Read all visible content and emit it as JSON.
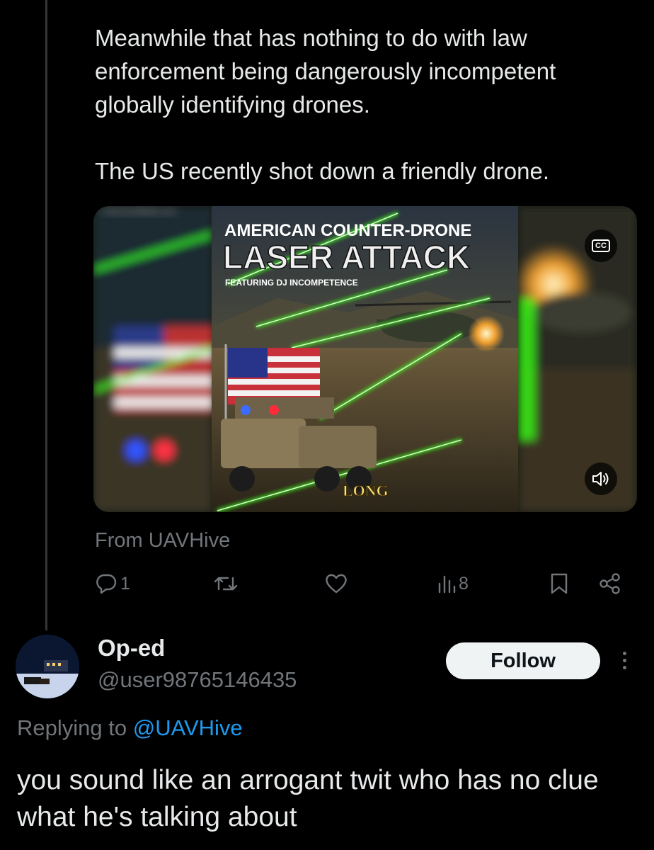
{
  "tweet": {
    "text_paragraph_1": "Meanwhile that has nothing to do with law enforcement being dangerously incompetent globally identifying drones.",
    "text_paragraph_2": "The US recently shot down a friendly drone.",
    "media": {
      "title_line_1": "AMERICAN COUNTER-DRONE",
      "title_line_2": "LASER ATTACK",
      "subtitle": "FEATURING DJ INCOMPETENCE",
      "badge": "LONG",
      "blur_text": "FEATURING DJ",
      "cc_label": "CC",
      "cc_icon": "closed-captions-icon",
      "mute_icon": "speaker-icon"
    },
    "source_label": "From UAVHive",
    "actions": {
      "reply_count": "1",
      "retweet_count": "",
      "like_count": "",
      "views_count": "8",
      "reply_icon": "reply-icon",
      "retweet_icon": "retweet-icon",
      "like_icon": "heart-icon",
      "views_icon": "views-icon",
      "bookmark_icon": "bookmark-icon",
      "share_icon": "share-icon"
    }
  },
  "reply": {
    "display_name": "Op-ed",
    "handle": "@user98765146435",
    "follow_label": "Follow",
    "replying_prefix": "Replying to",
    "replying_to": "@UAVHive",
    "text": "you sound like an arrogant twit who has no clue what he's talking about"
  },
  "colors": {
    "background": "#000000",
    "text": "#e7e9ea",
    "muted": "#71767b",
    "link": "#1d9bf0",
    "laser": "#39ff14"
  }
}
